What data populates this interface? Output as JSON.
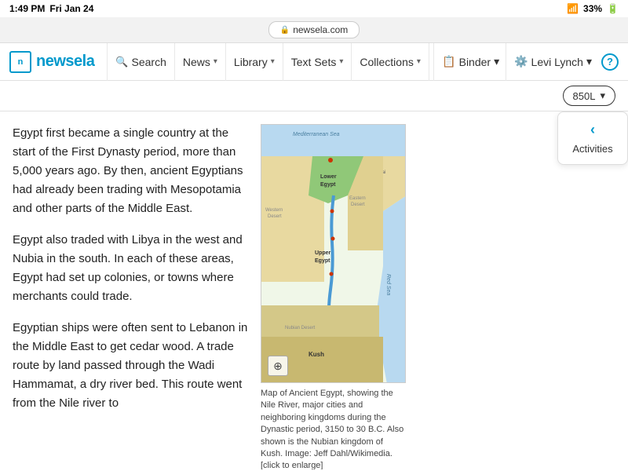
{
  "statusBar": {
    "time": "1:49 PM",
    "date": "Fri Jan 24",
    "url": "newsela.com",
    "wifi": "WiFi",
    "signal": "33%",
    "battery": "🔋"
  },
  "navbar": {
    "logo": "newsela",
    "items": [
      {
        "label": "Search",
        "icon": "search",
        "hasDropdown": false
      },
      {
        "label": "News",
        "hasDropdown": true
      },
      {
        "label": "Library",
        "hasDropdown": true
      },
      {
        "label": "Text Sets",
        "hasDropdown": true
      },
      {
        "label": "Collections",
        "hasDropdown": true
      }
    ],
    "binder": "Binder",
    "user": "Levi Lynch",
    "help": "?"
  },
  "readingLevel": {
    "level": "850L",
    "dropdownIcon": "▾"
  },
  "article": {
    "paragraphs": [
      "Egypt first became a single country at the start of the First Dynasty period, more than 5,000 years ago. By then, ancient Egyptians had already been trading with Mesopotamia and other parts of the Middle East.",
      "Egypt also traded with Libya in the west and Nubia in the south. In each of these areas, Egypt had set up colonies, or towns where merchants could trade.",
      "Egyptian ships were often sent to Lebanon in the Middle East to get cedar wood. A trade route by land passed through the Wadi Hammamat, a dry river bed. This route went from the Nile river to"
    ]
  },
  "map": {
    "altText": "Map of Ancient Egypt showing Nile River",
    "labels": {
      "mediterranean": "Mediterranean Sea",
      "redSea": "Red Sea",
      "lowerEgypt": "Lower Egypt",
      "upperEgypt": "Upper Egypt",
      "kush": "Kush",
      "westernDesert": "Western Desert",
      "easternDesert": "Eastern Desert",
      "nubianDesert": "Nubian Desert",
      "sinai": "Sinai"
    },
    "caption": "Map of Ancient Egypt, showing the Nile River, major cities and neighboring kingdoms during the Dynastic period, 3150 to 30 B.C. Also shown is the Nubian kingdom of Kush. Image: Jeff Dahl/Wikimedia. [click to enlarge]",
    "zoomIcon": "⊕"
  },
  "activities": {
    "chevron": "‹",
    "label": "Activities"
  }
}
